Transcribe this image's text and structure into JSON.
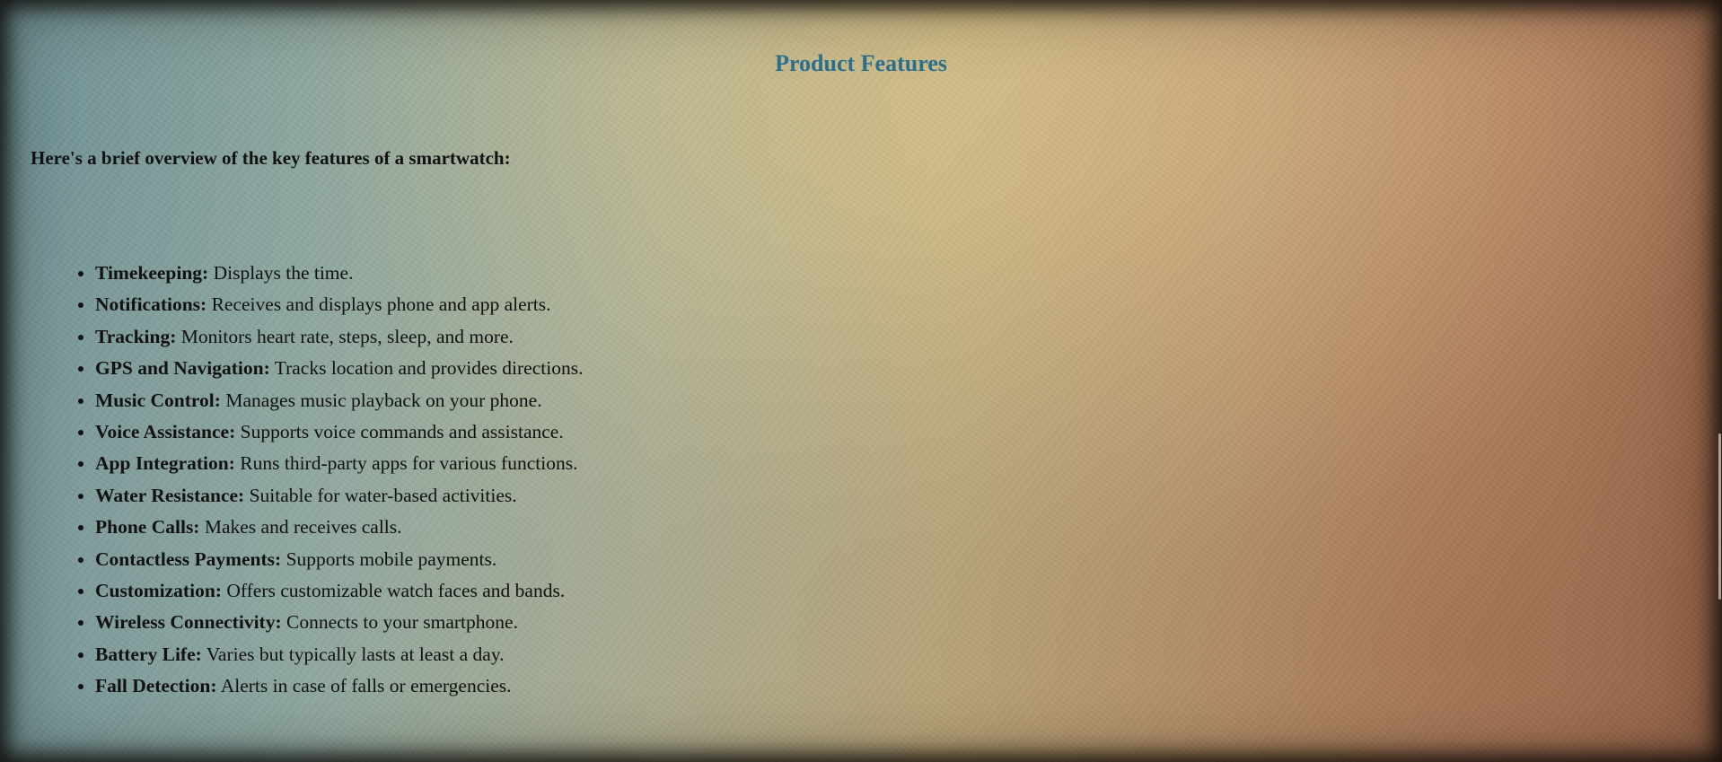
{
  "page": {
    "title": "Product Features",
    "intro": "Here's a brief overview of the key features of a smartwatch:",
    "colors": {
      "title": "#2b6f8e",
      "text": "#111111"
    }
  },
  "features": [
    {
      "name": "Timekeeping:",
      "description": " Displays the time."
    },
    {
      "name": "Notifications:",
      "description": " Receives and displays phone and app alerts."
    },
    {
      "name": "Tracking:",
      "description": " Monitors heart rate, steps, sleep, and more."
    },
    {
      "name": "GPS and Navigation:",
      "description": " Tracks location and provides directions."
    },
    {
      "name": "Music Control:",
      "description": " Manages music playback on your phone."
    },
    {
      "name": "Voice Assistance:",
      "description": " Supports voice commands and assistance."
    },
    {
      "name": "App Integration:",
      "description": " Runs third-party apps for various functions."
    },
    {
      "name": "Water Resistance:",
      "description": " Suitable for water-based activities."
    },
    {
      "name": "Phone Calls:",
      "description": " Makes and receives calls."
    },
    {
      "name": "Contactless Payments:",
      "description": " Supports mobile payments."
    },
    {
      "name": "Customization:",
      "description": " Offers customizable watch faces and bands."
    },
    {
      "name": "Wireless Connectivity:",
      "description": " Connects to your smartphone."
    },
    {
      "name": "Battery Life:",
      "description": " Varies but typically lasts at least a day."
    },
    {
      "name": "Fall Detection:",
      "description": " Alerts in case of falls or emergencies."
    }
  ]
}
